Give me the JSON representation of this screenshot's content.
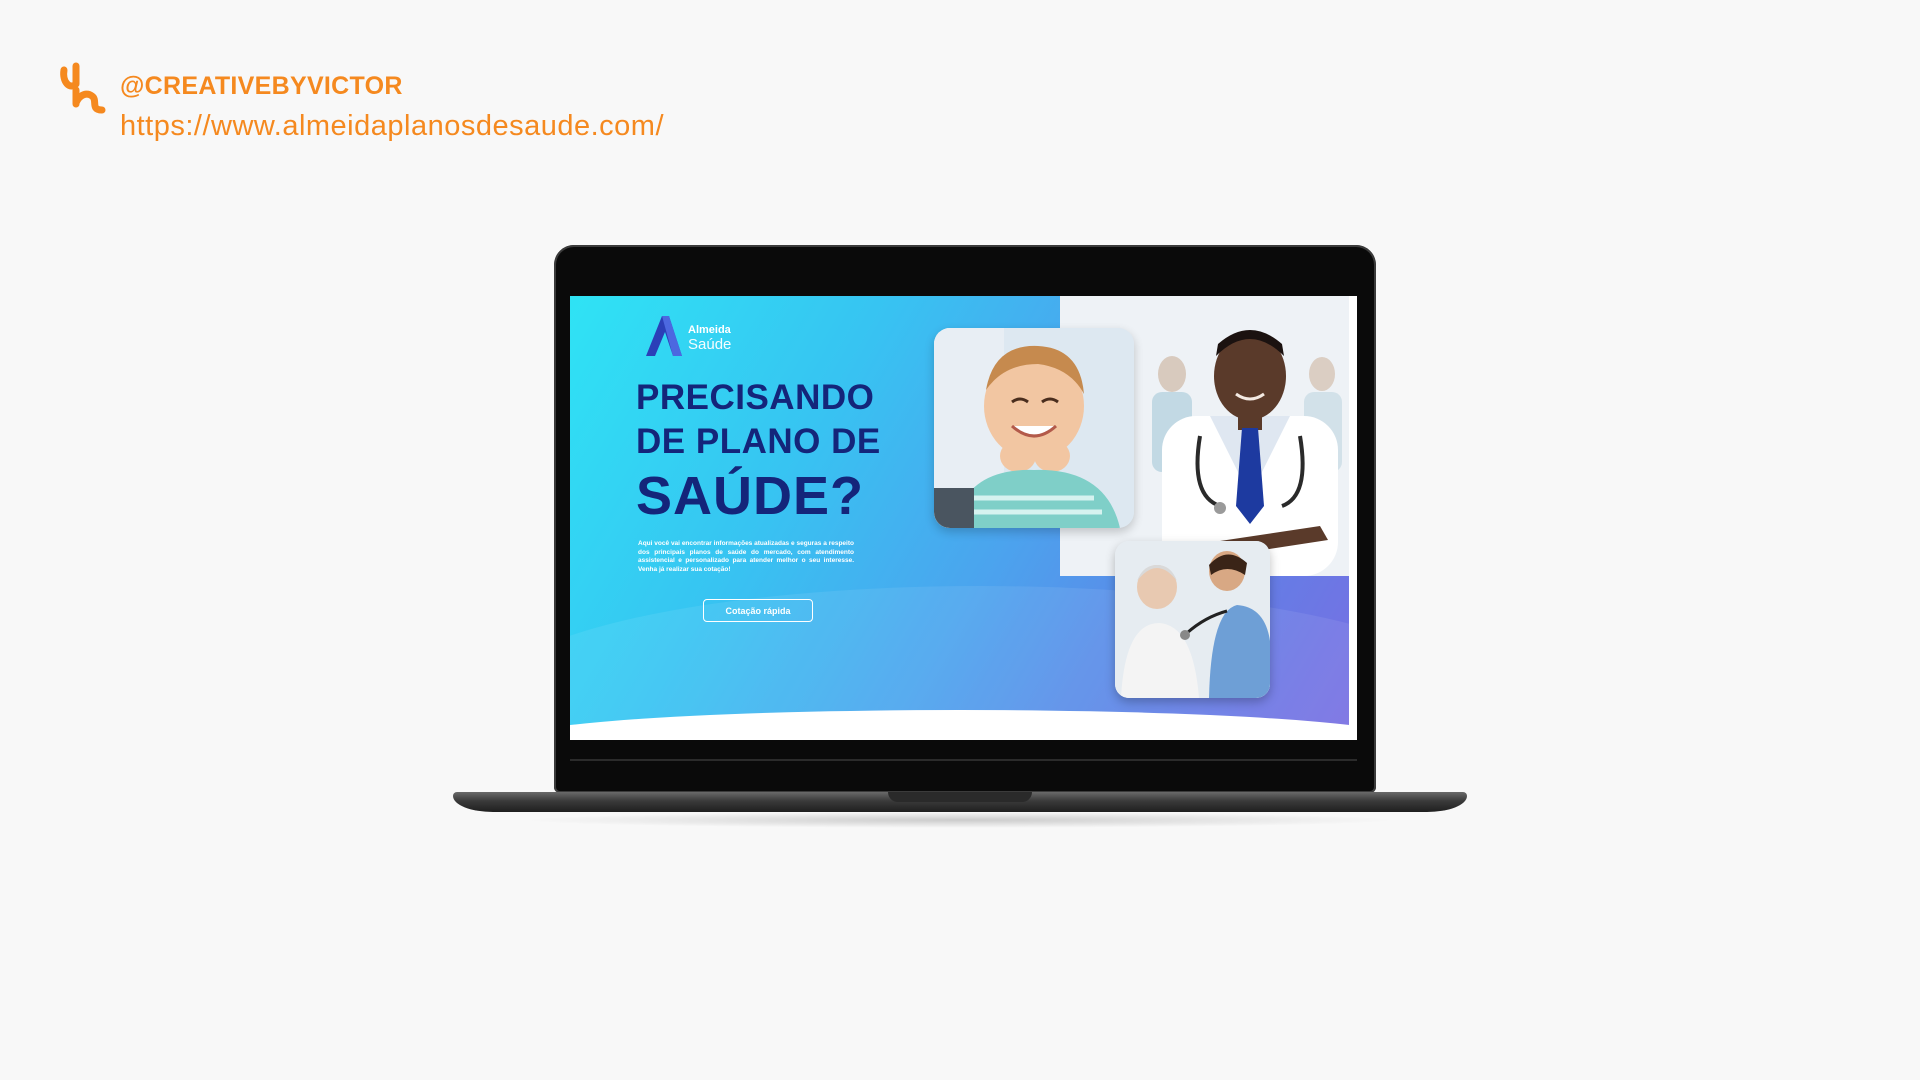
{
  "credit": {
    "handle": "@CREATIVEBYVICTOR",
    "url": "https://www.almeidaplanosdesaude.com/",
    "logo_icon": "vh-monogram-icon",
    "accent_color": "#f5891f"
  },
  "site": {
    "brand": {
      "name_line1": "Almeida",
      "name_line2": "Saúde",
      "logo_icon": "letter-a-logo-icon"
    },
    "headline": {
      "line1": "PRECISANDO",
      "line2": "DE PLANO DE",
      "line3": "SAÚDE?"
    },
    "description": "Aqui você vai encontrar informações atualizadas e seguras a respeito dos principais planos de saúde do mercado, com atendimento assistencial e personalizado para atender melhor o seu interesse. Venha já realizar sua cotação!",
    "cta_label": "Cotação rápida",
    "photos": {
      "child": "smiling-child-photo",
      "doctor": "doctor-with-stethoscope-photo",
      "elder": "doctor-examining-elderly-woman-photo"
    },
    "colors": {
      "headline": "#14257a",
      "gradient_start": "#2fe3f4",
      "gradient_end": "#7a6de2"
    }
  }
}
